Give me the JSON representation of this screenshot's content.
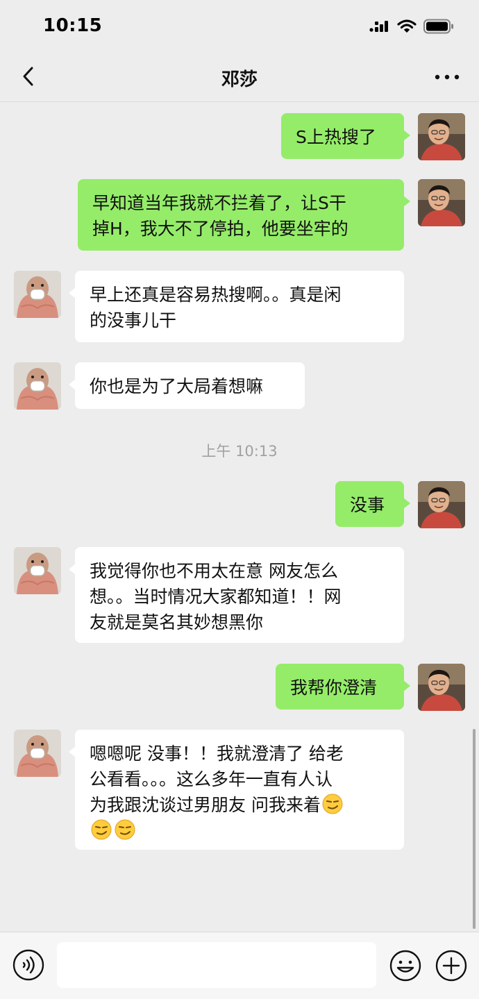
{
  "status_bar": {
    "time": "10:15"
  },
  "header": {
    "title": "邓莎"
  },
  "messages": [
    {
      "side": "out",
      "lines": [
        "S上热搜了"
      ]
    },
    {
      "side": "out",
      "lines": [
        "早知道当年我就不拦着了，让S干",
        "掉H，我大不了停拍，他要坐牢的"
      ]
    },
    {
      "side": "in",
      "lines": [
        "早上还真是容易热搜啊。。真是闲",
        "的没事儿干"
      ]
    },
    {
      "side": "in",
      "lines": [
        "你也是为了大局着想嘛"
      ]
    },
    {
      "side": "out",
      "lines": [
        "没事"
      ]
    },
    {
      "side": "in",
      "lines": [
        "我觉得你也不用太在意 网友怎么",
        "想。。当时情况大家都知道！！网",
        "友就是莫名其妙想黑你"
      ]
    },
    {
      "side": "out",
      "lines": [
        "我帮你澄清"
      ]
    },
    {
      "side": "in",
      "lines": [
        "嗯嗯呢 没事！！我就澄清了 给老",
        "公看看。。。这么多年一直有人认",
        "为我跟沈谈过男朋友 问我来着"
      ]
    }
  ],
  "timestamp": "上午 10:13",
  "emoji_trail": [
    "smirk-emoji",
    "smirk-emoji",
    "smirk-emoji"
  ],
  "input": {
    "placeholder": ""
  },
  "colors": {
    "outgoing_bubble": "#95ec69",
    "incoming_bubble": "#ffffff",
    "background": "#ededed"
  }
}
